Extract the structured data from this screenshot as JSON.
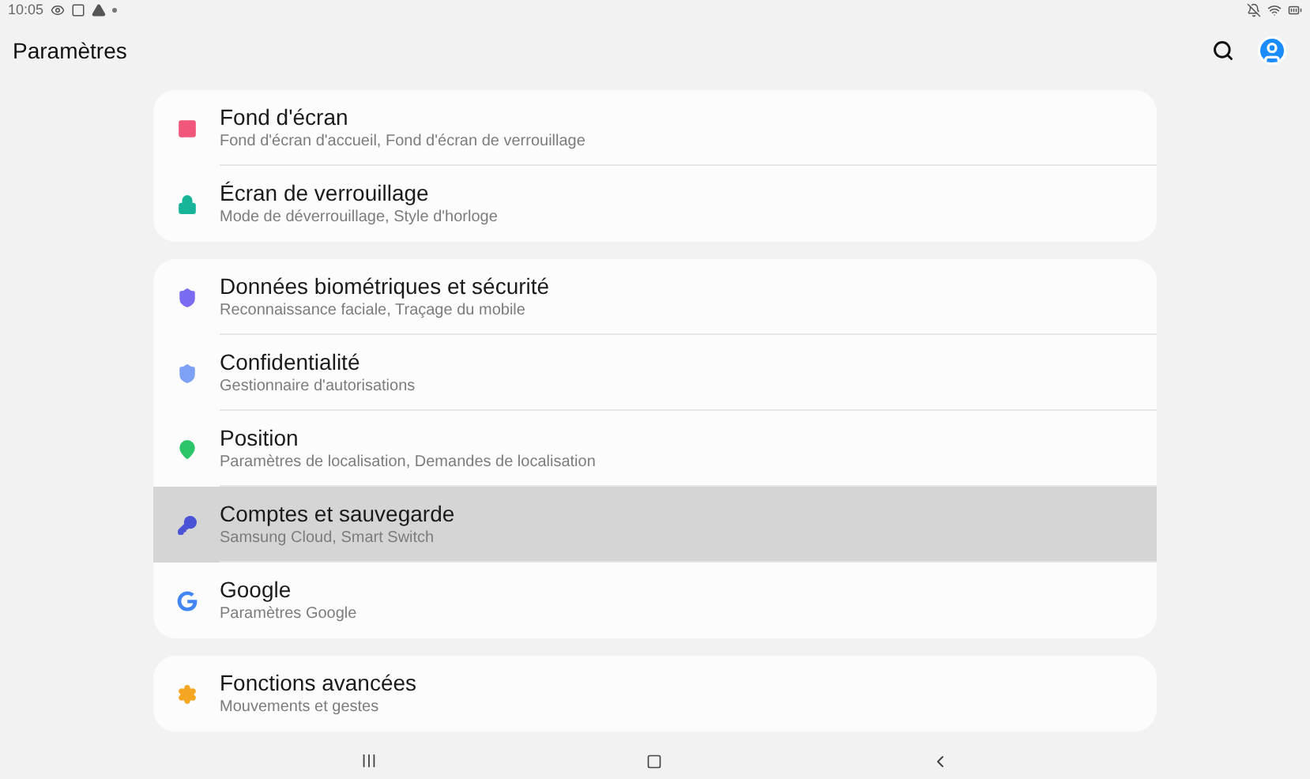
{
  "status_bar": {
    "time": "10:05"
  },
  "header": {
    "title": "Paramètres"
  },
  "groups": [
    {
      "items": [
        {
          "title": "Fond d'écran",
          "subtitle": "Fond d'écran d'accueil, Fond d'écran de verrouillage",
          "color": "#f0577a",
          "selected": false
        },
        {
          "title": "Écran de verrouillage",
          "subtitle": "Mode de déverrouillage, Style d'horloge",
          "color": "#16b59a",
          "selected": false
        }
      ]
    },
    {
      "items": [
        {
          "title": "Données biométriques et sécurité",
          "subtitle": "Reconnaissance faciale, Traçage du mobile",
          "color": "#7a6cf0",
          "selected": false
        },
        {
          "title": "Confidentialité",
          "subtitle": "Gestionnaire d'autorisations",
          "color": "#7da2f5",
          "selected": false
        },
        {
          "title": "Position",
          "subtitle": "Paramètres de localisation, Demandes de localisation",
          "color": "#2dc56a",
          "selected": false
        },
        {
          "title": "Comptes et sauvegarde",
          "subtitle": "Samsung Cloud, Smart Switch",
          "color": "#4a52d6",
          "selected": true
        },
        {
          "title": "Google",
          "subtitle": "Paramètres Google",
          "color": "#4285f4",
          "selected": false
        }
      ]
    },
    {
      "items": [
        {
          "title": "Fonctions avancées",
          "subtitle": "Mouvements et gestes",
          "color": "#f5a623",
          "selected": false
        }
      ]
    }
  ]
}
